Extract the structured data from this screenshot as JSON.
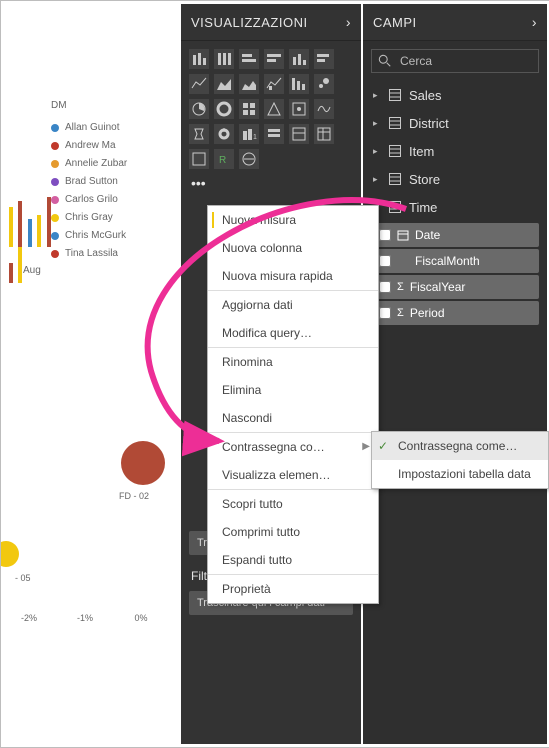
{
  "viz_header": "VISUALIZZAZIONI",
  "fields_header": "CAMPI",
  "search_placeholder": "Cerca",
  "tables": [
    "Sales",
    "District",
    "Item",
    "Store",
    "Time"
  ],
  "time_fields": [
    {
      "label": "Date",
      "checked": false,
      "icon": "cal"
    },
    {
      "label": "FiscalMonth",
      "checked": false,
      "icon": ""
    },
    {
      "label": "FiscalYear",
      "checked": false,
      "icon": "sigma"
    },
    {
      "label": "Period",
      "checked": false,
      "icon": "sigma"
    }
  ],
  "ctx_items": [
    "Nuova misura",
    "Nuova colonna",
    "Nuova misura rapida",
    "Aggiorna dati",
    "Modifica query…",
    "Rinomina",
    "Elimina",
    "Nascondi",
    "Contrassegna co…",
    "Visualizza elemen…",
    "Scopri tutto",
    "Comprimi tutto",
    "Espandi tutto",
    "Proprietà"
  ],
  "submenu_items": [
    {
      "label": "Contrassegna come…",
      "checked": true
    },
    {
      "label": "Impostazioni tabella data",
      "checked": false
    }
  ],
  "wells": {
    "drill": "Trascinare qui i campi di dri…",
    "report_filters": "Filtri a livello di report",
    "report_drop": "Trascinare qui i campi dati"
  },
  "legend": {
    "title": "DM",
    "items": [
      {
        "label": "Allan Guinot",
        "color": "#3a85c6"
      },
      {
        "label": "Andrew Ma",
        "color": "#c0392b"
      },
      {
        "label": "Annelie Zubar",
        "color": "#e59a2e"
      },
      {
        "label": "Brad Sutton",
        "color": "#7e4ec0"
      },
      {
        "label": "Carlos Grilo",
        "color": "#d35fa1"
      },
      {
        "label": "Chris Gray",
        "color": "#f2c80f"
      },
      {
        "label": "Chris McGurk",
        "color": "#3a85c6"
      },
      {
        "label": "Tina Lassila",
        "color": "#c0392b"
      }
    ]
  },
  "month": "Aug",
  "axis": [
    "-2%",
    "-1%",
    "0%"
  ],
  "bubble_labels": {
    "brown": "FD - 02",
    "yellow": "- 05"
  }
}
